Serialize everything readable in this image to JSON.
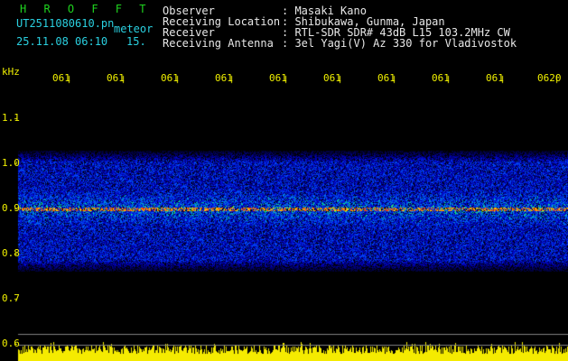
{
  "header": {
    "program_title": "H R O F F T",
    "filename": "UT2511080610.pn",
    "type_label": "meteor",
    "datetime": "25.11.08 06:10",
    "interval": "15.",
    "info": [
      {
        "label": "Observer",
        "value": ": Masaki Kano"
      },
      {
        "label": "Receiving Location",
        "value": ": Shibukawa, Gunma, Japan"
      },
      {
        "label": "Receiver",
        "value": ": RTL-SDR SDR# 43dB L15 103.2MHz CW"
      },
      {
        "label": "Receiving Antenna",
        "value": ": 3el Yagi(V) Az 330 for Vladivostok"
      }
    ]
  },
  "colors": {
    "text": "#e8e8e8",
    "title": "#1fd41f",
    "meta": "#2ad0e0",
    "axis": "#f0f000",
    "background": "#000000",
    "baseline": "#808080"
  },
  "chart_data": {
    "type": "heatmap",
    "y_unit_label": "kHz",
    "y_ticks": [
      "1.1",
      "1.0",
      "0.9",
      "0.8",
      "0.7",
      "0.6"
    ],
    "x_ticks": [
      "061",
      "061",
      "061",
      "061",
      "061",
      "061",
      "061",
      "061",
      "061",
      "0620"
    ],
    "ylim": [
      0.6,
      1.15
    ],
    "noise_band_khz": [
      0.77,
      1.02
    ],
    "signal_line_khz": 0.9,
    "bottom_panel": "yellow amplitude strip"
  }
}
